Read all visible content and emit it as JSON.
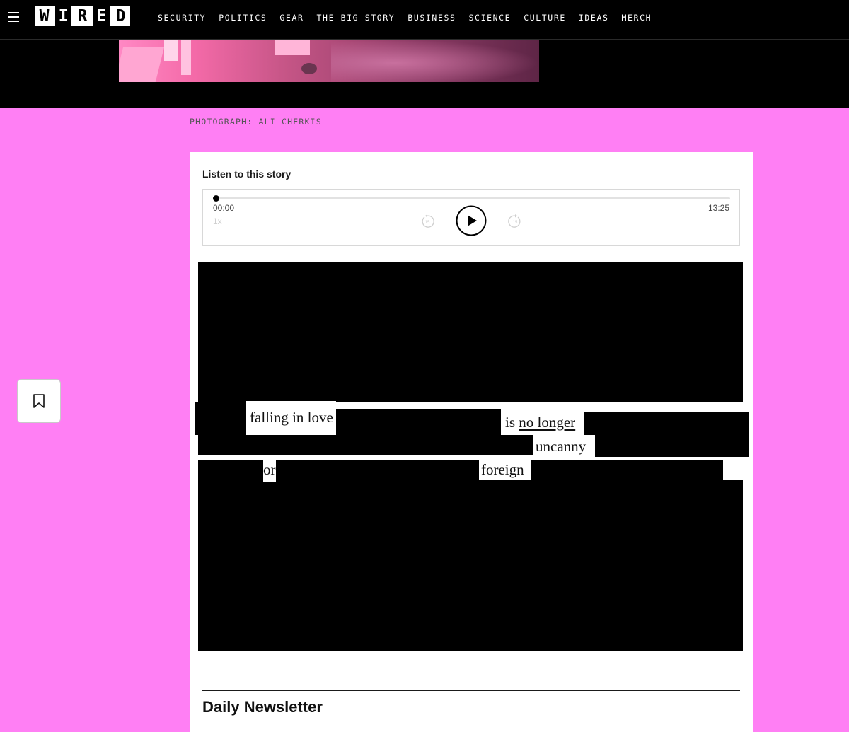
{
  "brand": {
    "logo_letters": [
      "W",
      "I",
      "R",
      "E",
      "D"
    ]
  },
  "nav": {
    "items": [
      {
        "label": "SECURITY"
      },
      {
        "label": "POLITICS"
      },
      {
        "label": "GEAR"
      },
      {
        "label": "THE BIG STORY"
      },
      {
        "label": "BUSINESS"
      },
      {
        "label": "SCIENCE"
      },
      {
        "label": "CULTURE"
      },
      {
        "label": "IDEAS"
      },
      {
        "label": "MERCH"
      }
    ]
  },
  "photo_credit": "PHOTOGRAPH: ALI CHERKIS",
  "audio": {
    "heading": "Listen to this story",
    "current_time": "00:00",
    "duration": "13:25",
    "speed": "1x",
    "skip_back_seconds": "15",
    "skip_forward_seconds": "15",
    "progress": 0
  },
  "article": {
    "w_falling": "falling in love",
    "w_is": "is",
    "w_no_longer": "no longer",
    "w_uncanny": "uncanny",
    "w_or": "or",
    "w_foreign": "foreign"
  },
  "newsletter": {
    "title": "Daily Newsletter"
  },
  "colors": {
    "page_background": "#ff7ff4",
    "nav_background": "#000000",
    "card_background": "#ffffff"
  },
  "icons": [
    "hamburger-menu-icon",
    "bookmark-icon",
    "skip-back-15-icon",
    "play-icon",
    "skip-forward-15-icon"
  ]
}
